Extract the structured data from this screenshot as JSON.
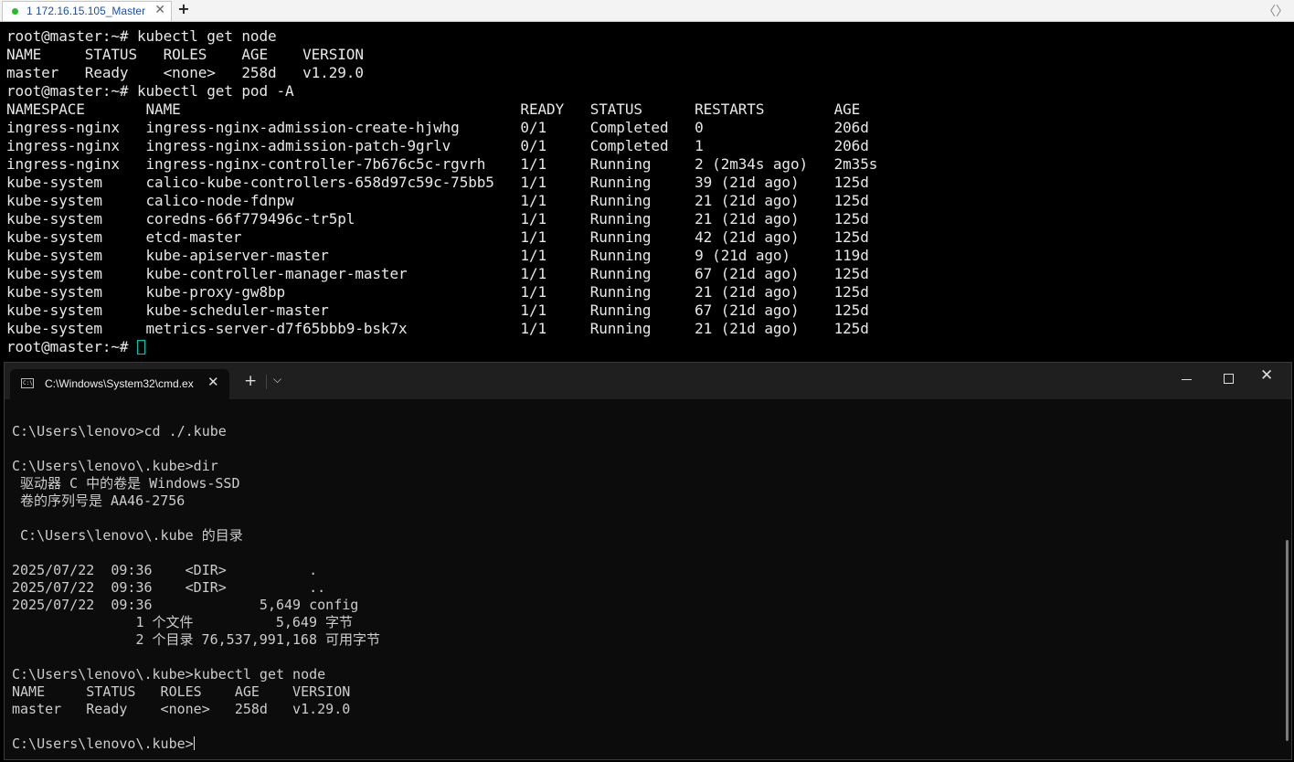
{
  "ssh": {
    "tab_label": "1 172.16.15.105_Master",
    "tab_close": "✕",
    "new_tab": "+",
    "nav_left": "〈",
    "nav_right": "〉",
    "lines": [
      "root@master:~# kubectl get node",
      "NAME     STATUS   ROLES    AGE    VERSION",
      "master   Ready    <none>   258d   v1.29.0",
      "root@master:~# kubectl get pod -A",
      "NAMESPACE       NAME                                       READY   STATUS      RESTARTS        AGE",
      "ingress-nginx   ingress-nginx-admission-create-hjwhg       0/1     Completed   0               206d",
      "ingress-nginx   ingress-nginx-admission-patch-9grlv        0/1     Completed   1               206d",
      "ingress-nginx   ingress-nginx-controller-7b676c5c-rgvrh    1/1     Running     2 (2m34s ago)   2m35s",
      "kube-system     calico-kube-controllers-658d97c59c-75bb5   1/1     Running     39 (21d ago)    125d",
      "kube-system     calico-node-fdnpw                          1/1     Running     21 (21d ago)    125d",
      "kube-system     coredns-66f779496c-tr5pl                   1/1     Running     21 (21d ago)    125d",
      "kube-system     etcd-master                                1/1     Running     42 (21d ago)    125d",
      "kube-system     kube-apiserver-master                      1/1     Running     9 (21d ago)     119d",
      "kube-system     kube-controller-manager-master             1/1     Running     67 (21d ago)    125d",
      "kube-system     kube-proxy-gw8bp                           1/1     Running     21 (21d ago)    125d",
      "kube-system     kube-scheduler-master                      1/1     Running     67 (21d ago)    125d",
      "kube-system     metrics-server-d7f65bbb9-bsk7x             1/1     Running     21 (21d ago)    125d"
    ],
    "prompt": "root@master:~# "
  },
  "cmd": {
    "tab_label": "C:\\Windows\\System32\\cmd.ex",
    "tab_close": "✕",
    "new_tab": "+",
    "dropdown": "⌵",
    "close": "✕",
    "lines": [
      "C:\\Users\\lenovo>cd ./.kube",
      "",
      "C:\\Users\\lenovo\\.kube>dir",
      " 驱动器 C 中的卷是 Windows-SSD",
      " 卷的序列号是 AA46-2756",
      "",
      " C:\\Users\\lenovo\\.kube 的目录",
      "",
      "2025/07/22  09:36    <DIR>          .",
      "2025/07/22  09:36    <DIR>          ..",
      "2025/07/22  09:36             5,649 config",
      "               1 个文件          5,649 字节",
      "               2 个目录 76,537,991,168 可用字节",
      "",
      "C:\\Users\\lenovo\\.kube>kubectl get node",
      "NAME     STATUS   ROLES    AGE    VERSION",
      "master   Ready    <none>   258d   v1.29.0",
      ""
    ],
    "prompt": "C:\\Users\\lenovo\\.kube>"
  }
}
